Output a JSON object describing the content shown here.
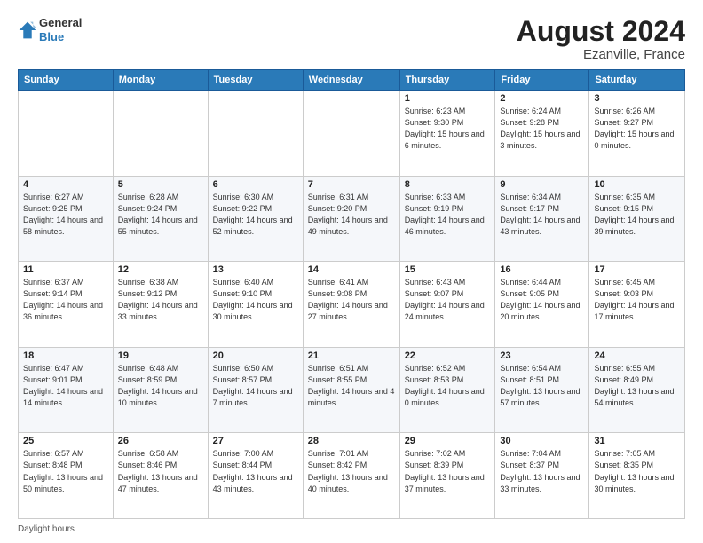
{
  "header": {
    "logo_line1": "General",
    "logo_line2": "Blue",
    "month_year": "August 2024",
    "location": "Ezanville, France"
  },
  "days_of_week": [
    "Sunday",
    "Monday",
    "Tuesday",
    "Wednesday",
    "Thursday",
    "Friday",
    "Saturday"
  ],
  "weeks": [
    [
      {
        "day": "",
        "info": ""
      },
      {
        "day": "",
        "info": ""
      },
      {
        "day": "",
        "info": ""
      },
      {
        "day": "",
        "info": ""
      },
      {
        "day": "1",
        "info": "Sunrise: 6:23 AM\nSunset: 9:30 PM\nDaylight: 15 hours\nand 6 minutes."
      },
      {
        "day": "2",
        "info": "Sunrise: 6:24 AM\nSunset: 9:28 PM\nDaylight: 15 hours\nand 3 minutes."
      },
      {
        "day": "3",
        "info": "Sunrise: 6:26 AM\nSunset: 9:27 PM\nDaylight: 15 hours\nand 0 minutes."
      }
    ],
    [
      {
        "day": "4",
        "info": "Sunrise: 6:27 AM\nSunset: 9:25 PM\nDaylight: 14 hours\nand 58 minutes."
      },
      {
        "day": "5",
        "info": "Sunrise: 6:28 AM\nSunset: 9:24 PM\nDaylight: 14 hours\nand 55 minutes."
      },
      {
        "day": "6",
        "info": "Sunrise: 6:30 AM\nSunset: 9:22 PM\nDaylight: 14 hours\nand 52 minutes."
      },
      {
        "day": "7",
        "info": "Sunrise: 6:31 AM\nSunset: 9:20 PM\nDaylight: 14 hours\nand 49 minutes."
      },
      {
        "day": "8",
        "info": "Sunrise: 6:33 AM\nSunset: 9:19 PM\nDaylight: 14 hours\nand 46 minutes."
      },
      {
        "day": "9",
        "info": "Sunrise: 6:34 AM\nSunset: 9:17 PM\nDaylight: 14 hours\nand 43 minutes."
      },
      {
        "day": "10",
        "info": "Sunrise: 6:35 AM\nSunset: 9:15 PM\nDaylight: 14 hours\nand 39 minutes."
      }
    ],
    [
      {
        "day": "11",
        "info": "Sunrise: 6:37 AM\nSunset: 9:14 PM\nDaylight: 14 hours\nand 36 minutes."
      },
      {
        "day": "12",
        "info": "Sunrise: 6:38 AM\nSunset: 9:12 PM\nDaylight: 14 hours\nand 33 minutes."
      },
      {
        "day": "13",
        "info": "Sunrise: 6:40 AM\nSunset: 9:10 PM\nDaylight: 14 hours\nand 30 minutes."
      },
      {
        "day": "14",
        "info": "Sunrise: 6:41 AM\nSunset: 9:08 PM\nDaylight: 14 hours\nand 27 minutes."
      },
      {
        "day": "15",
        "info": "Sunrise: 6:43 AM\nSunset: 9:07 PM\nDaylight: 14 hours\nand 24 minutes."
      },
      {
        "day": "16",
        "info": "Sunrise: 6:44 AM\nSunset: 9:05 PM\nDaylight: 14 hours\nand 20 minutes."
      },
      {
        "day": "17",
        "info": "Sunrise: 6:45 AM\nSunset: 9:03 PM\nDaylight: 14 hours\nand 17 minutes."
      }
    ],
    [
      {
        "day": "18",
        "info": "Sunrise: 6:47 AM\nSunset: 9:01 PM\nDaylight: 14 hours\nand 14 minutes."
      },
      {
        "day": "19",
        "info": "Sunrise: 6:48 AM\nSunset: 8:59 PM\nDaylight: 14 hours\nand 10 minutes."
      },
      {
        "day": "20",
        "info": "Sunrise: 6:50 AM\nSunset: 8:57 PM\nDaylight: 14 hours\nand 7 minutes."
      },
      {
        "day": "21",
        "info": "Sunrise: 6:51 AM\nSunset: 8:55 PM\nDaylight: 14 hours\nand 4 minutes."
      },
      {
        "day": "22",
        "info": "Sunrise: 6:52 AM\nSunset: 8:53 PM\nDaylight: 14 hours\nand 0 minutes."
      },
      {
        "day": "23",
        "info": "Sunrise: 6:54 AM\nSunset: 8:51 PM\nDaylight: 13 hours\nand 57 minutes."
      },
      {
        "day": "24",
        "info": "Sunrise: 6:55 AM\nSunset: 8:49 PM\nDaylight: 13 hours\nand 54 minutes."
      }
    ],
    [
      {
        "day": "25",
        "info": "Sunrise: 6:57 AM\nSunset: 8:48 PM\nDaylight: 13 hours\nand 50 minutes."
      },
      {
        "day": "26",
        "info": "Sunrise: 6:58 AM\nSunset: 8:46 PM\nDaylight: 13 hours\nand 47 minutes."
      },
      {
        "day": "27",
        "info": "Sunrise: 7:00 AM\nSunset: 8:44 PM\nDaylight: 13 hours\nand 43 minutes."
      },
      {
        "day": "28",
        "info": "Sunrise: 7:01 AM\nSunset: 8:42 PM\nDaylight: 13 hours\nand 40 minutes."
      },
      {
        "day": "29",
        "info": "Sunrise: 7:02 AM\nSunset: 8:39 PM\nDaylight: 13 hours\nand 37 minutes."
      },
      {
        "day": "30",
        "info": "Sunrise: 7:04 AM\nSunset: 8:37 PM\nDaylight: 13 hours\nand 33 minutes."
      },
      {
        "day": "31",
        "info": "Sunrise: 7:05 AM\nSunset: 8:35 PM\nDaylight: 13 hours\nand 30 minutes."
      }
    ]
  ],
  "note": "Daylight hours"
}
